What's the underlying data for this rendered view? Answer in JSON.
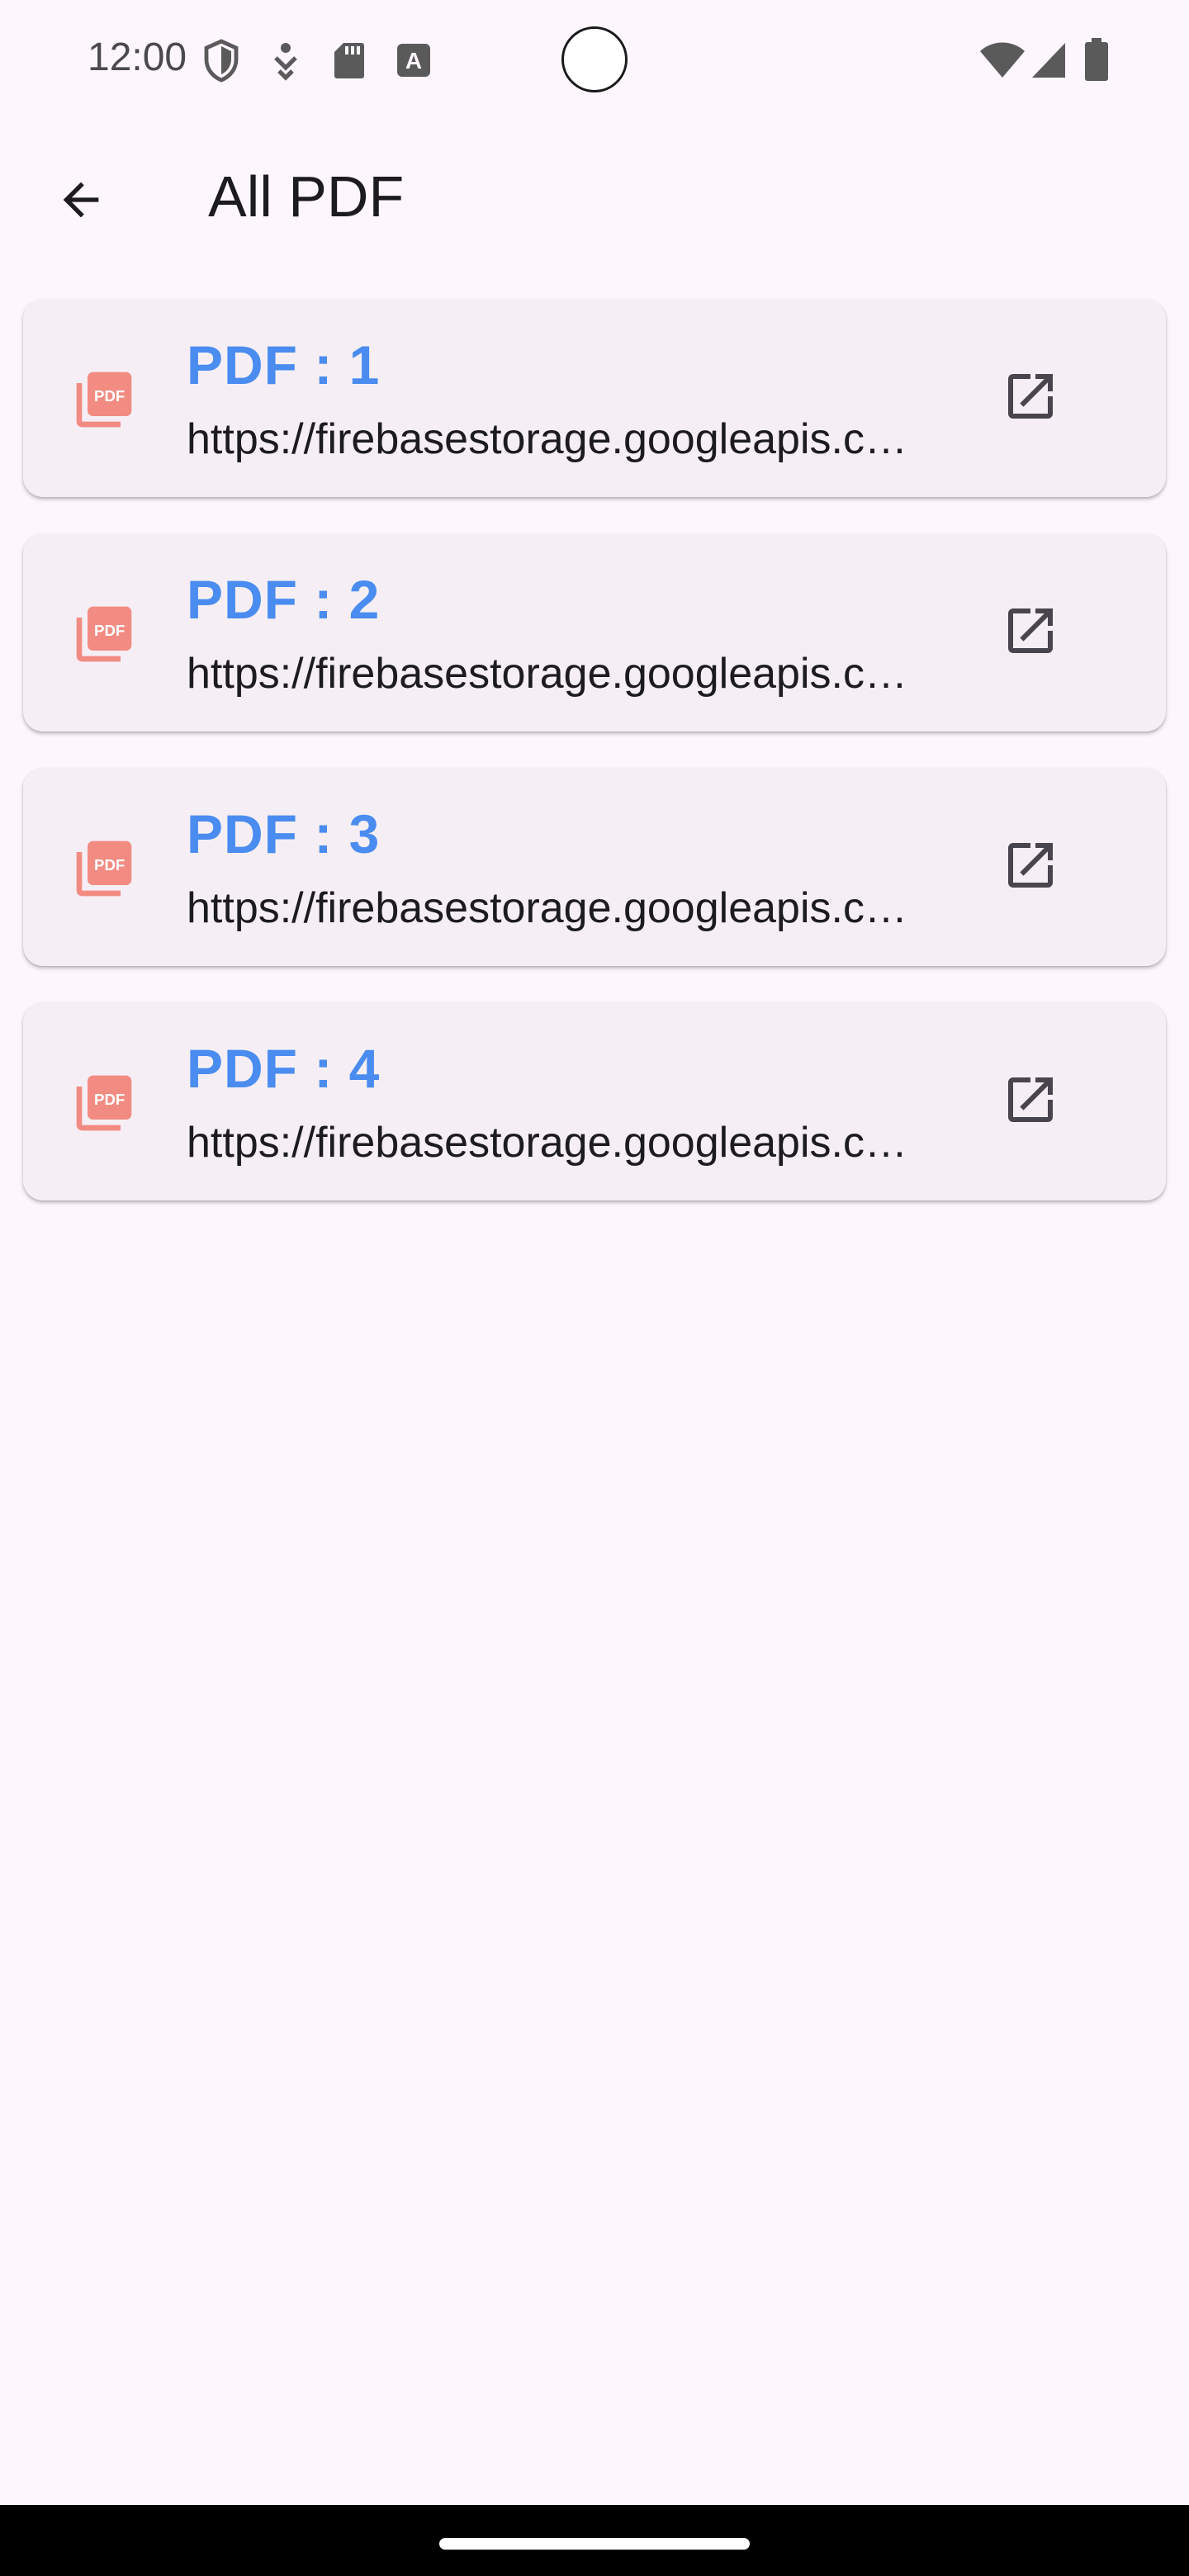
{
  "status_bar": {
    "time": "12:00",
    "icons_left": [
      "shield-icon",
      "accessibility-icon",
      "sd-card-icon",
      "font-a-icon"
    ],
    "icons_right": [
      "wifi-icon",
      "cell-signal-icon",
      "battery-icon"
    ]
  },
  "app_bar": {
    "back_icon": "arrow-back-icon",
    "title": "All PDF"
  },
  "pdf_items": [
    {
      "title": "PDF : 1",
      "url": "https://firebasestorage.googleapis.com/..."
    },
    {
      "title": "PDF : 2",
      "url": "https://firebasestorage.googleapis.com/..."
    },
    {
      "title": "PDF : 3",
      "url": "https://firebasestorage.googleapis.com/..."
    },
    {
      "title": "PDF : 4",
      "url": "https://firebasestorage.googleapis.com/..."
    }
  ],
  "colors": {
    "background": "#fdf7fd",
    "card": "#f5eff5",
    "title_accent": "#4a8cf0",
    "pdf_icon": "#f28b82"
  }
}
